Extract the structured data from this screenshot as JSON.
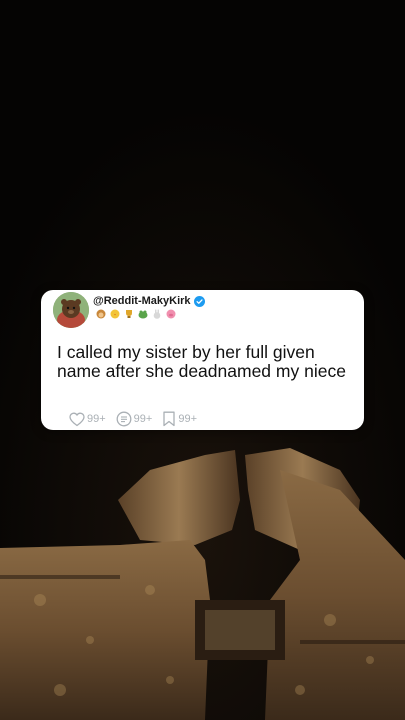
{
  "post": {
    "handle": "@Reddit-MakyKirk",
    "text": "I called my sister by her full given name after she deadnamed my niece",
    "verified": true
  },
  "badges": [
    {
      "icon": "monkey-emoji-icon",
      "color": "#c8873a"
    },
    {
      "icon": "chick-emoji-icon",
      "color": "#f2c438"
    },
    {
      "icon": "trophy-emoji-icon",
      "color": "#e0a62a"
    },
    {
      "icon": "frog-emoji-icon",
      "color": "#5aa44b"
    },
    {
      "icon": "rabbit-emoji-icon",
      "color": "#c9c9c9"
    },
    {
      "icon": "pig-emoji-icon",
      "color": "#f08fae"
    }
  ],
  "actions": {
    "likes": "99+",
    "comments": "99+",
    "saves": "99+"
  },
  "colors": {
    "card_bg": "#ffffff",
    "verified_blue": "#1d9bf0",
    "action_gray": "#aab0b5"
  }
}
